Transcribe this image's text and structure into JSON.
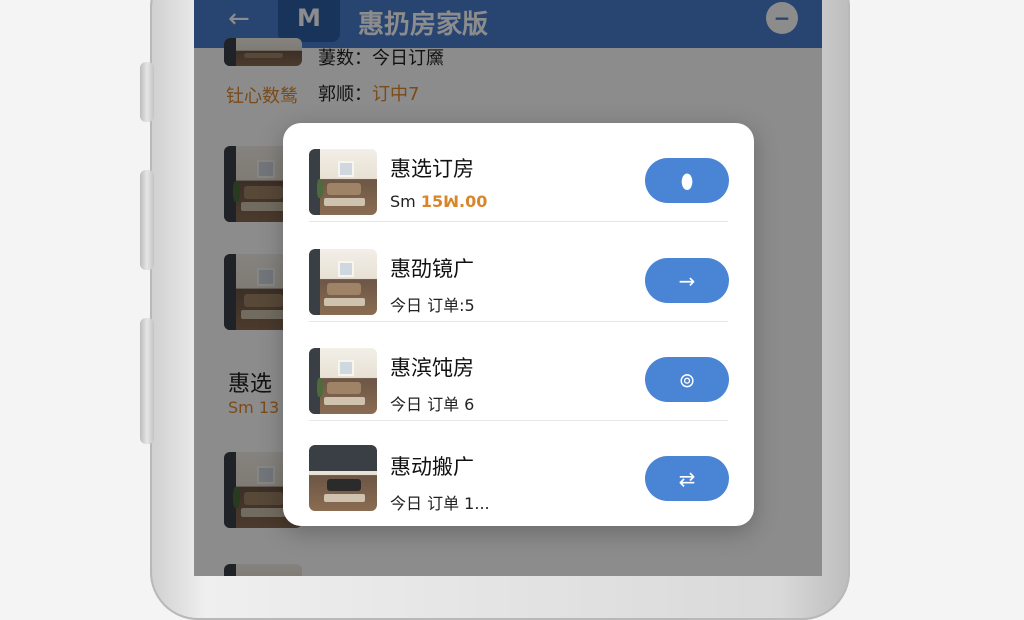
{
  "app": {
    "title": "惠扔房家版",
    "back_icon": "←",
    "logo_text": "M",
    "message_icon": "−"
  },
  "background": {
    "row1_label": "stats-icon",
    "row1_text": "萋数：今日订黡",
    "row1_orange": "钍心数鸶",
    "row1_text2": "郭顺：",
    "row1_text2_orange": "订中7",
    "row3_title": "惠选",
    "row3_sub": "Sm 13"
  },
  "modal": {
    "items": [
      {
        "name": "惠选订房",
        "sub_prefix": "Sm ",
        "sub_value": "15.00",
        "sub_value_display": "15ꟽ.00",
        "button_icon": "⬮",
        "icon_name": "toggle-icon"
      },
      {
        "name": "惠劭镜广",
        "sub_prefix": "今日 订单:5",
        "sub_value": "",
        "button_icon": "→",
        "icon_name": "arrow-right-icon"
      },
      {
        "name": "惠滨饨房",
        "sub_prefix": "今日 订单 6",
        "sub_value": "",
        "button_icon": "⊚",
        "icon_name": "link-icon"
      },
      {
        "name": "惠动搬广",
        "sub_prefix": "今日 订单 1...",
        "sub_value": "",
        "button_icon": "⇄",
        "icon_name": "swap-icon"
      }
    ]
  },
  "colors": {
    "header": "#4a7fd0",
    "button": "#4a84d4",
    "accent": "#d9862b"
  }
}
